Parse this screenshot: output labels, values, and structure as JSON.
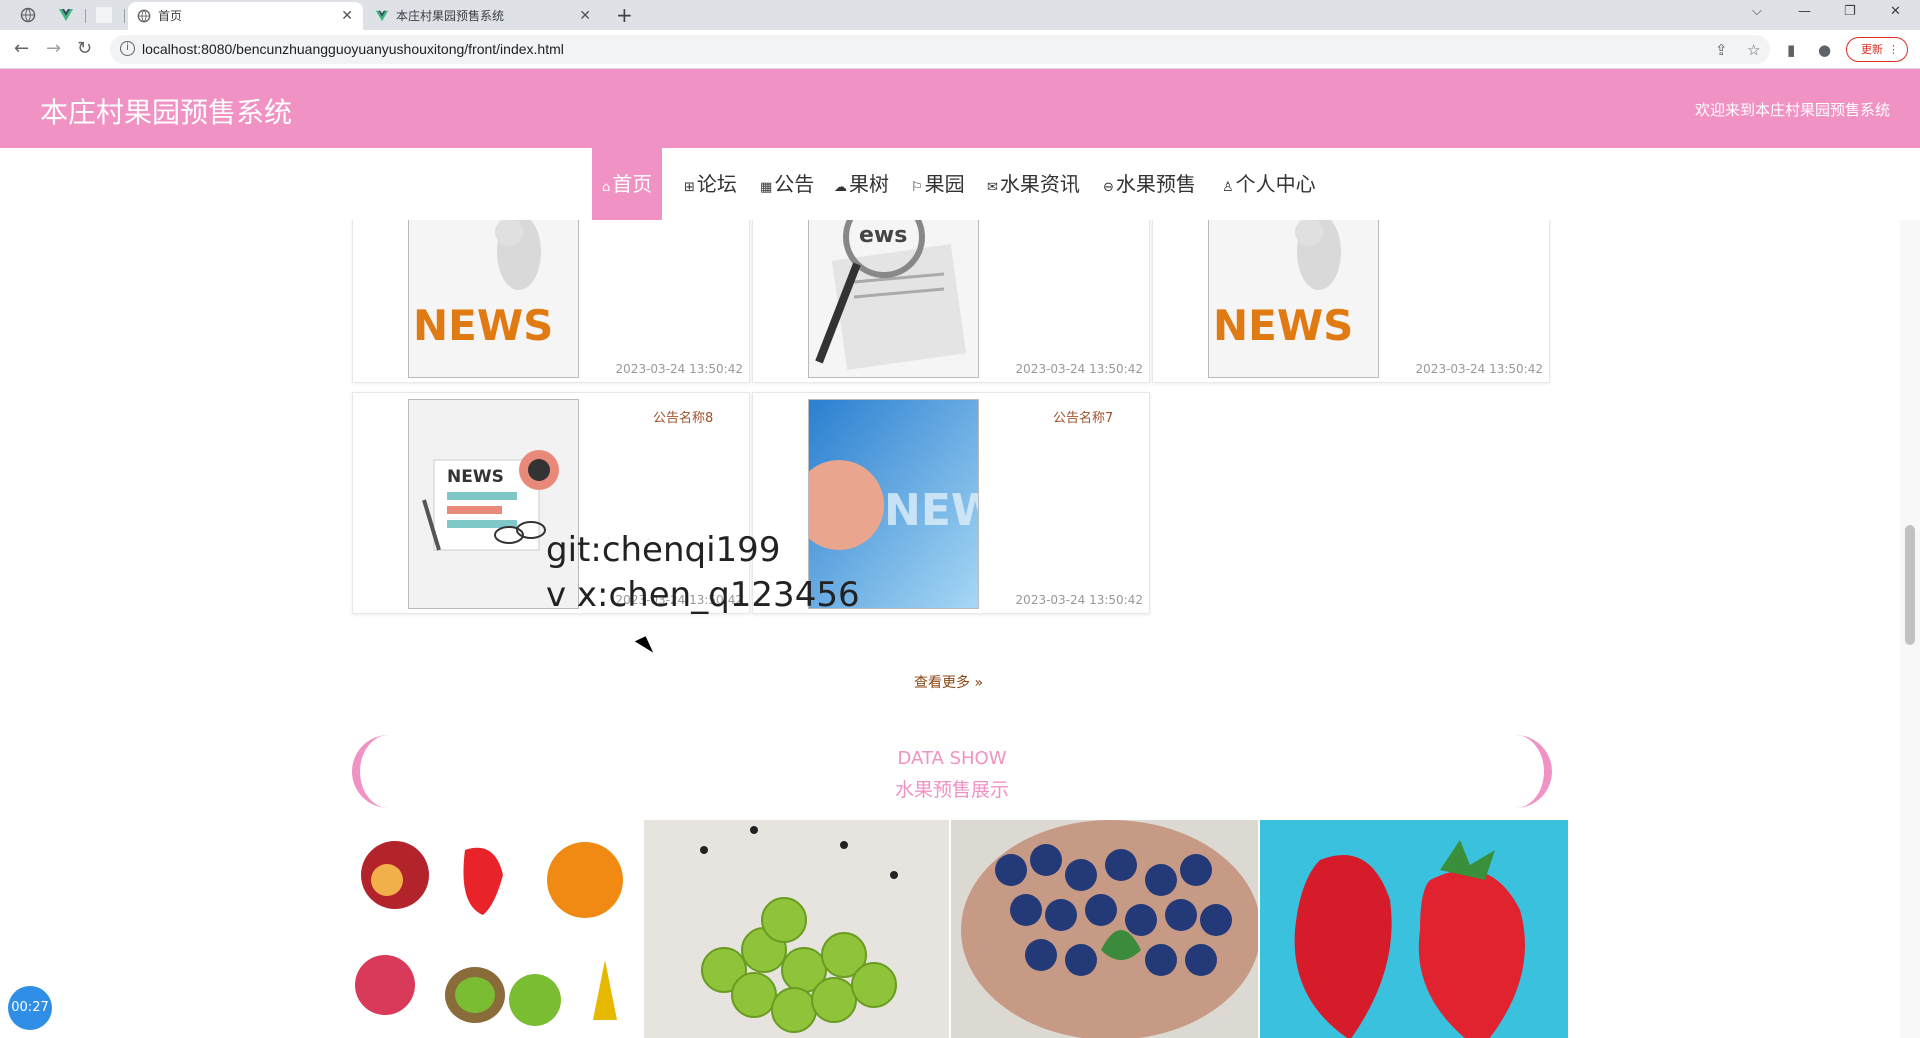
{
  "browser": {
    "tabs": [
      {
        "title": "首页",
        "active": true
      },
      {
        "title": "本庄村果园预售系统",
        "active": false
      }
    ],
    "url": "localhost:8080/bencunzhuangguoyuanyushouxitong/front/index.html",
    "update_label": "更新"
  },
  "site": {
    "title": "本庄村果园预售系统",
    "welcome": "欢迎来到本庄村果园预售系统",
    "colors": {
      "primary": "#f092c4",
      "accent_text": "#a0522d"
    }
  },
  "nav": {
    "items": [
      {
        "label": "首页",
        "icon": "home-icon",
        "active": true
      },
      {
        "label": "论坛",
        "icon": "grid-icon"
      },
      {
        "label": "公告",
        "icon": "calendar-icon"
      },
      {
        "label": "果树",
        "icon": "cloud-icon"
      },
      {
        "label": "果园",
        "icon": "flag-icon"
      },
      {
        "label": "水果资讯",
        "icon": "mail-icon"
      },
      {
        "label": "水果预售",
        "icon": "shop-icon"
      },
      {
        "label": "个人中心",
        "icon": "user-icon"
      }
    ]
  },
  "notices": [
    {
      "name": "",
      "date": "2023-03-24 13:50:42",
      "thumb": "news-figure-image"
    },
    {
      "name": "",
      "date": "2023-03-24 13:50:42",
      "thumb": "magnifier-newspaper-image"
    },
    {
      "name": "",
      "date": "2023-03-24 13:50:42",
      "thumb": "news-figure-image"
    },
    {
      "name": "公告名称8",
      "date": "2023-03-24 13:50:42",
      "thumb": "news-paper-illustration"
    },
    {
      "name": "公告名称7",
      "date": "2023-03-24 13:50:42",
      "thumb": "news-globe-image"
    }
  ],
  "more_label": "查看更多",
  "data_show": {
    "en": "DATA SHOW",
    "cn": "水果预售展示"
  },
  "fruits": [
    "mixed-fruits-image",
    "green-grapes-image",
    "blueberries-image",
    "strawberries-image"
  ],
  "watermark": {
    "line1": "git:chenqi199",
    "line2": "v x:chen_q123456"
  },
  "timer": "00:27"
}
